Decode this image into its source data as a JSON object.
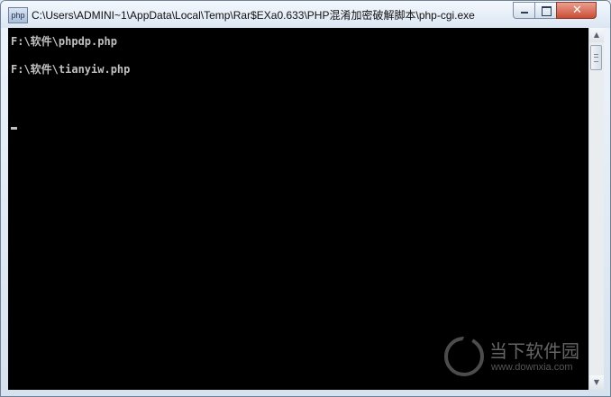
{
  "window": {
    "icon_label": "php",
    "title": "C:\\Users\\ADMINI~1\\AppData\\Local\\Temp\\Rar$EXa0.633\\PHP混淆加密破解脚本\\php-cgi.exe",
    "controls": {
      "minimize": "minimize-icon",
      "maximize": "maximize-icon",
      "close_glyph": "✕"
    }
  },
  "console": {
    "lines": [
      "F:\\软件\\phpdp.php",
      "F:\\软件\\tianyiw.php"
    ]
  },
  "scrollbar": {
    "up_glyph": "▲",
    "down_glyph": "▼"
  },
  "watermark": {
    "name": "当下软件园",
    "url": "www.downxia.com"
  }
}
